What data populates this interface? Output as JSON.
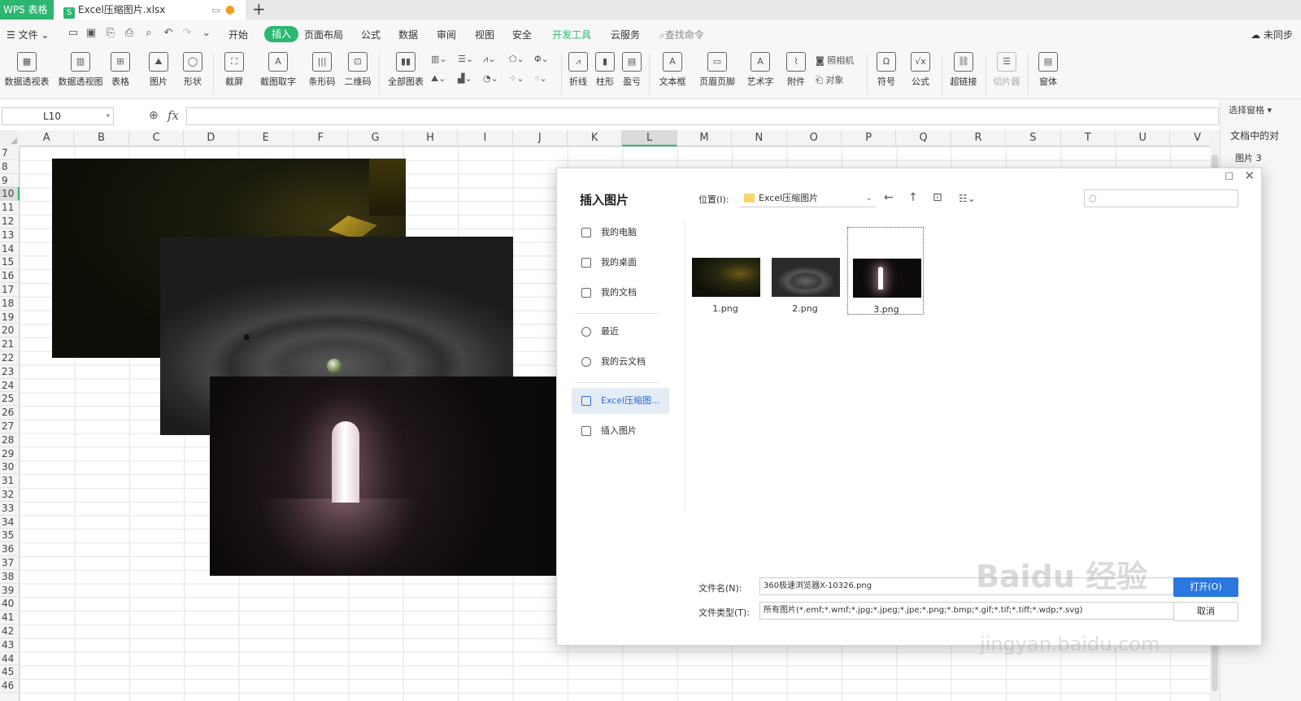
{
  "titlebar": {
    "app_tab": "WPS 表格",
    "doc_tab": "Excel压缩图片.xlsx",
    "doc_icon": "S",
    "new_tab": "+"
  },
  "menu": {
    "file": "☰ 文件 ⌄",
    "items": [
      "开始",
      "插入",
      "页面布局",
      "公式",
      "数据",
      "审阅",
      "视图",
      "安全",
      "开发工具",
      "云服务"
    ],
    "search": "查找命令",
    "sync": "未同步"
  },
  "ribbon": {
    "buttons": [
      "数据透视表",
      "数据透视图",
      "表格",
      "图片",
      "形状",
      "截屏",
      "截图取字",
      "条形码",
      "二维码",
      "全部图表",
      "折线",
      "柱形",
      "盈亏",
      "文本框",
      "页眉页脚",
      "艺术字",
      "附件",
      "符号",
      "公式",
      "超链接",
      "切片器",
      "窗体"
    ],
    "photo": "照相机",
    "object": "对象"
  },
  "formula": {
    "cell_ref": "L10",
    "fx": "fx"
  },
  "sheet": {
    "columns": [
      "A",
      "B",
      "C",
      "D",
      "E",
      "F",
      "G",
      "H",
      "I",
      "J",
      "K",
      "L",
      "M",
      "N",
      "O",
      "P",
      "Q",
      "R",
      "S",
      "T",
      "U",
      "V"
    ],
    "rows": [
      "7",
      "8",
      "9",
      "10",
      "11",
      "12",
      "13",
      "14",
      "15",
      "16",
      "17",
      "18",
      "19",
      "20",
      "21",
      "22",
      "23",
      "24",
      "25",
      "26",
      "27",
      "28",
      "29",
      "30",
      "31",
      "32",
      "33",
      "34",
      "35",
      "36",
      "37",
      "38",
      "39",
      "40",
      "41",
      "42",
      "43",
      "44",
      "45",
      "46"
    ],
    "active_col": "L",
    "active_row": "10"
  },
  "right_panel": {
    "select_pane": "选择窗格",
    "title": "文档中的对",
    "item": "图片 3"
  },
  "dialog": {
    "title": "插入图片",
    "location_label": "位置(I):",
    "location_value": "Excel压缩图片",
    "nav": [
      "我的电脑",
      "我的桌面",
      "我的文档",
      "最近",
      "我的云文档",
      "Excel压缩图...",
      "插入图片"
    ],
    "files": [
      "1.png",
      "2.png",
      "3.png"
    ],
    "selected_file": "3.png",
    "filename_label": "文件名(N):",
    "filename_value": "360极速浏览器X-10326.png",
    "filetype_label": "文件类型(T):",
    "filetype_value": "所有图片(*.emf;*.wmf;*.jpg;*.jpeg;*.jpe;*.png;*.bmp;*.gif;*.tif;*.tiff;*.wdp;*.svg)",
    "open": "打开(O)",
    "cancel": "取消"
  },
  "watermark": {
    "text": "Baidu 经验",
    "url": "jingyan.baidu.com"
  },
  "colors": {
    "accent": "#2db671",
    "selection_blue": "#2a77e0"
  }
}
